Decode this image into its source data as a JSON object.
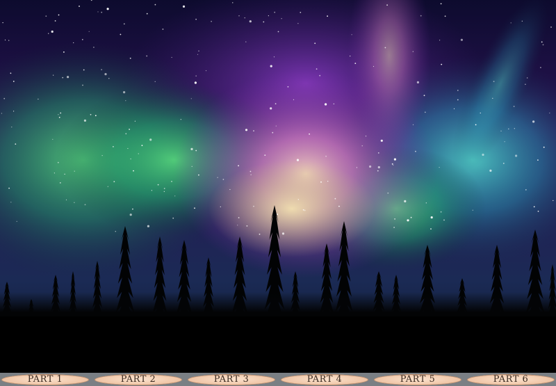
{
  "scene": {
    "description_icon": "aurora-forest-image",
    "sky_colors": [
      "#14103a",
      "#5a1f8a",
      "#d77fc3",
      "#f2d2b0",
      "#3fd27a",
      "#29c9c4"
    ]
  },
  "nav": {
    "items": [
      {
        "label": "PART 1"
      },
      {
        "label": "PART 2"
      },
      {
        "label": "PART 3"
      },
      {
        "label": "PART 4"
      },
      {
        "label": "PART 5"
      },
      {
        "label": "PART 6"
      }
    ]
  }
}
